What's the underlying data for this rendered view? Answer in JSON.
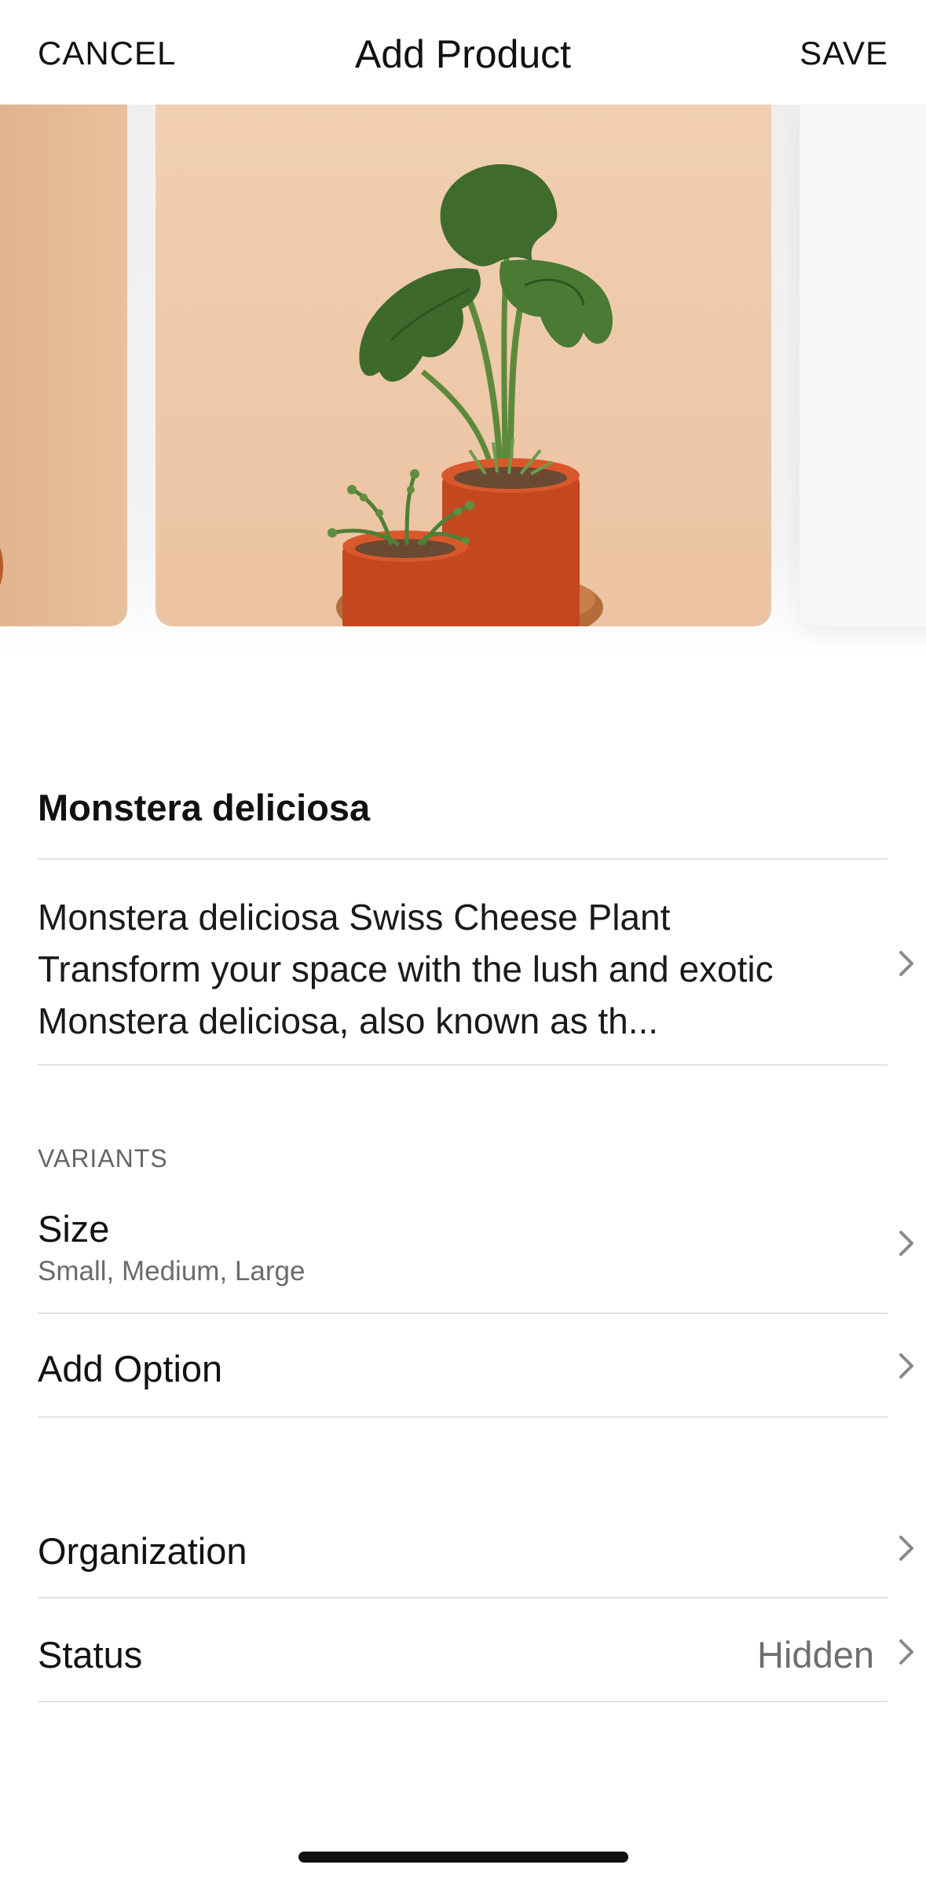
{
  "header": {
    "cancel_label": "CANCEL",
    "title": "Add Product",
    "save_label": "SAVE"
  },
  "product": {
    "name": "Monstera deliciosa",
    "description": "Monstera deliciosa Swiss Cheese Plant Transform your space with the lush and exotic Monstera deliciosa, also known as th..."
  },
  "variants": {
    "section_label": "VARIANTS",
    "size_title": "Size",
    "size_values": "Small, Medium, Large",
    "add_option_label": "Add Option"
  },
  "organization_label": "Organization",
  "status": {
    "label": "Status",
    "value": "Hidden"
  },
  "colors": {
    "background": "#ffffff",
    "divider": "#e2e2e2",
    "secondary_text": "#6b6b6b",
    "photo_backdrop": "#ebc3a2",
    "pot": "#c4471f"
  },
  "icons": {
    "chevron": "chevron-right-icon"
  }
}
